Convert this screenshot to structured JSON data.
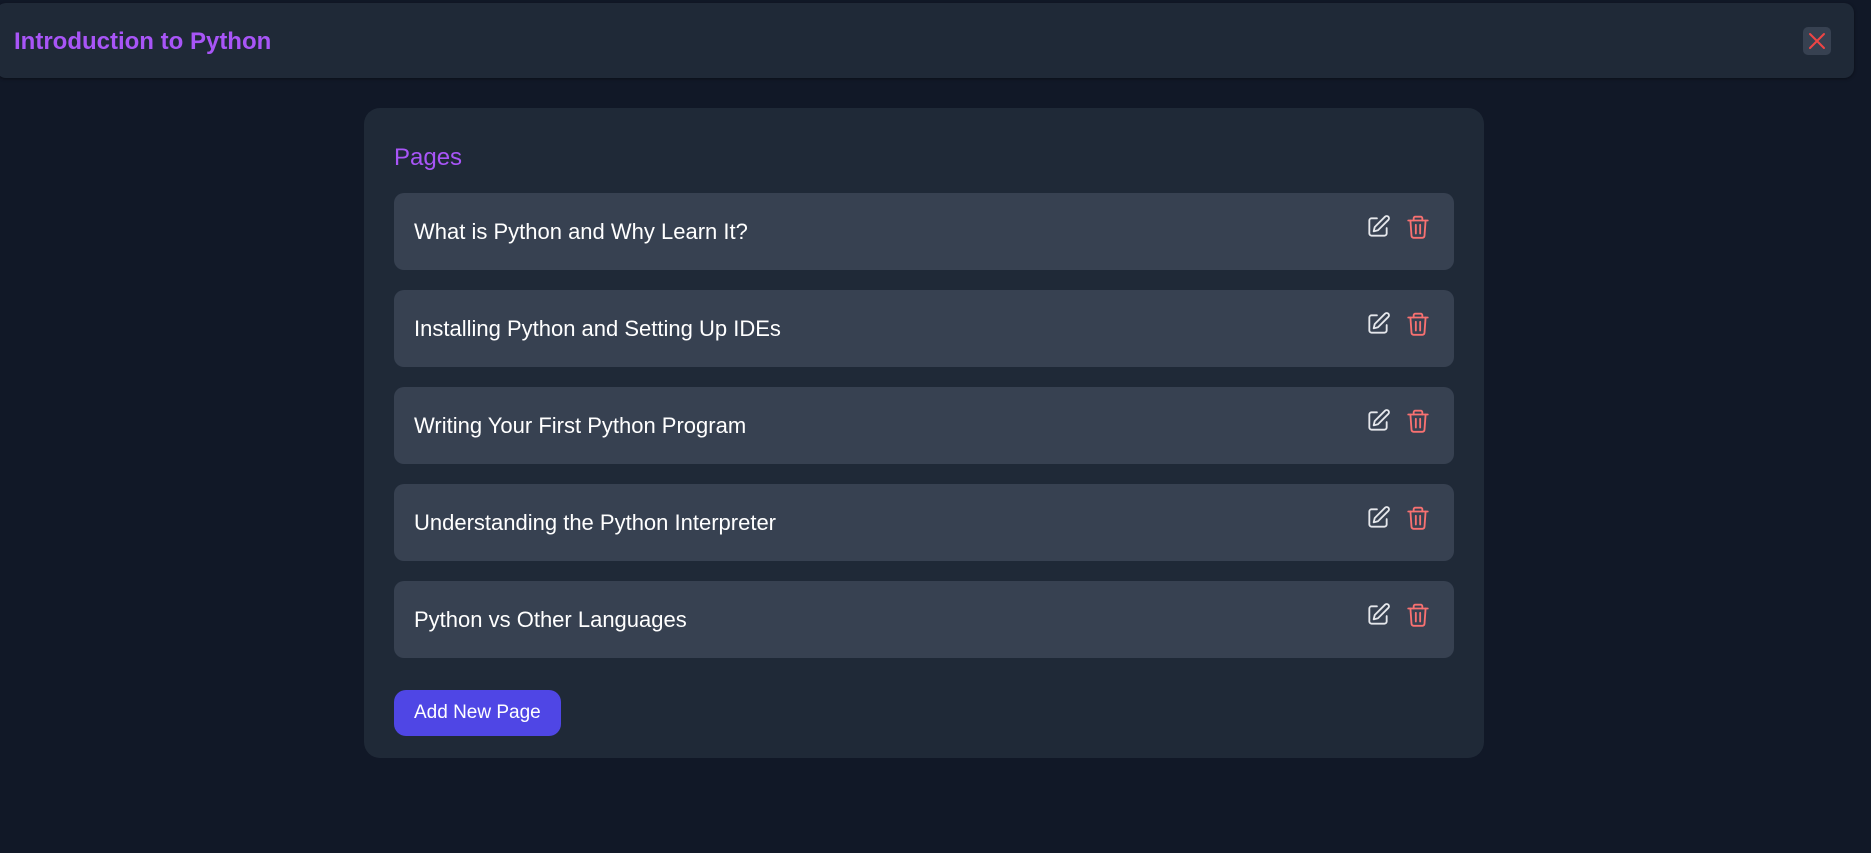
{
  "header": {
    "title": "Introduction to Python",
    "close_icon": "close-icon",
    "title_color": "#a855f7",
    "close_color": "#ef4444"
  },
  "pages_panel": {
    "heading": "Pages",
    "items": [
      {
        "title": "What is Python and Why Learn It?"
      },
      {
        "title": "Installing Python and Setting Up IDEs"
      },
      {
        "title": "Writing Your First Python Program"
      },
      {
        "title": "Understanding the Python Interpreter"
      },
      {
        "title": "Python vs Other Languages"
      }
    ],
    "item_icons": [
      "edit-icon",
      "trash-icon"
    ],
    "edit_icon_color": "#e5e7eb",
    "delete_icon_color": "#f87171",
    "add_button_label": "Add New Page",
    "add_button_color": "#4f46e5"
  }
}
